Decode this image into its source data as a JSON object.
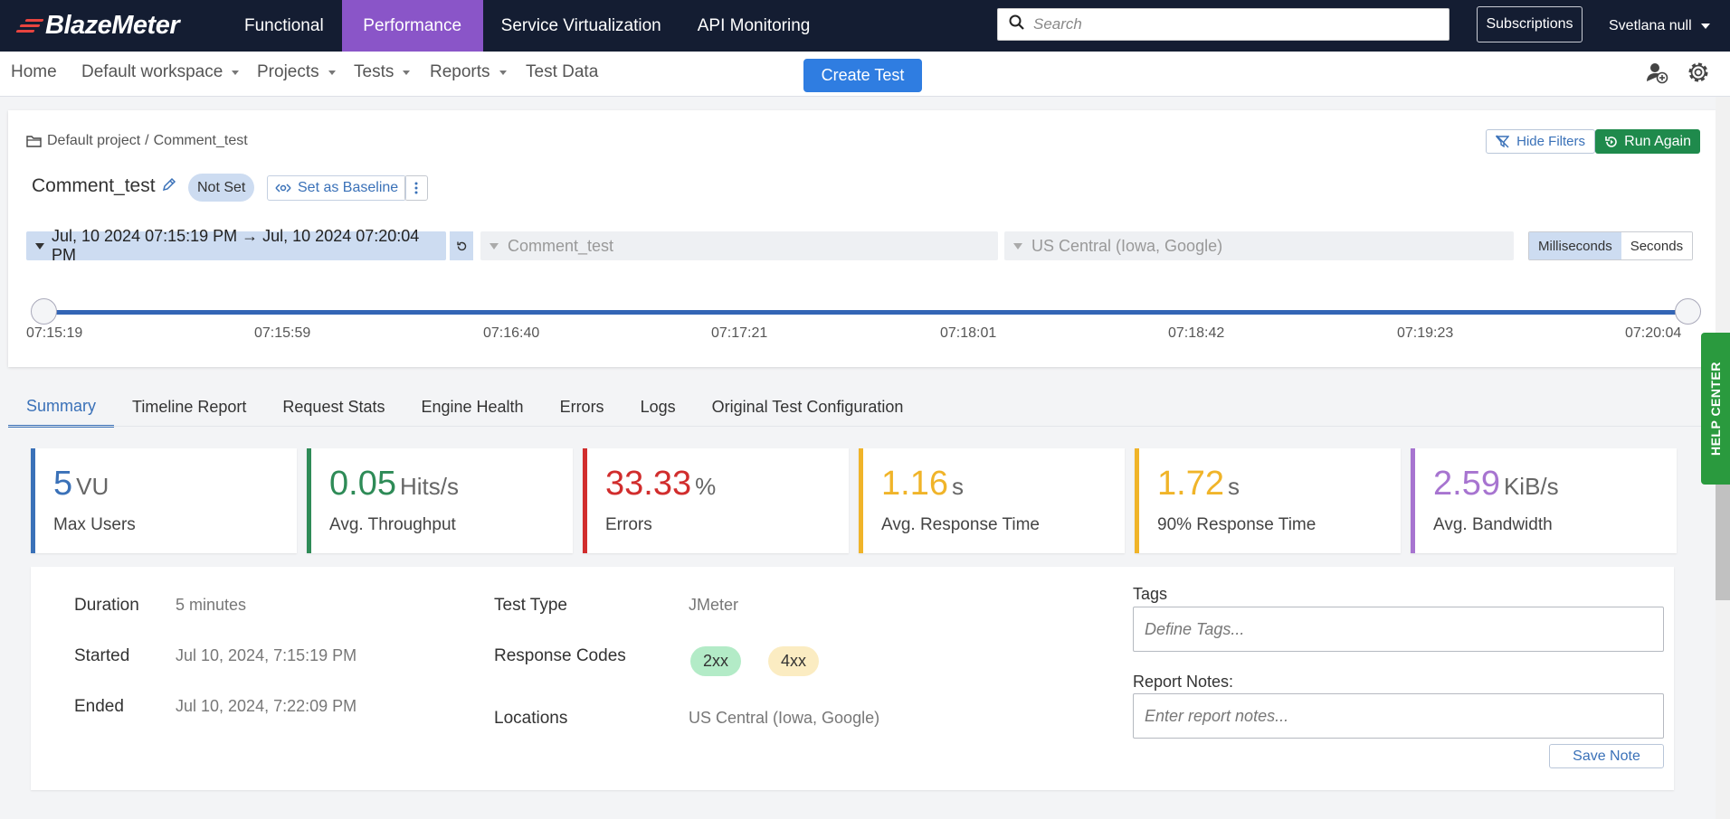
{
  "brand": {
    "logo_text": "BlazeMeter"
  },
  "topnav": {
    "items": [
      {
        "label": "Functional"
      },
      {
        "label": "Performance"
      },
      {
        "label": "Service Virtualization"
      },
      {
        "label": "API Monitoring"
      }
    ],
    "search_placeholder": "Search",
    "subscriptions_label": "Subscriptions",
    "user_name": "Svetlana null"
  },
  "subnav": {
    "home": "Home",
    "workspace": "Default workspace",
    "projects": "Projects",
    "tests": "Tests",
    "reports": "Reports",
    "test_data": "Test Data",
    "create_test": "Create Test"
  },
  "header": {
    "breadcrumb_project": "Default project",
    "breadcrumb_sep": "/",
    "breadcrumb_test": "Comment_test",
    "hide_filters": "Hide Filters",
    "run_again": "Run Again",
    "title": "Comment_test",
    "baseline_status": "Not Set",
    "set_baseline": "Set as Baseline",
    "date_range": "Jul, 10 2024 07:15:19 PM → Jul, 10 2024 07:20:04 PM",
    "scenario_filter": "Comment_test",
    "location_filter": "US Central (Iowa, Google)",
    "unit_ms": "Milliseconds",
    "unit_s": "Seconds",
    "timeline_ticks": [
      "07:15:19",
      "07:15:59",
      "07:16:40",
      "07:17:21",
      "07:18:01",
      "07:18:42",
      "07:19:23",
      "07:20:04"
    ]
  },
  "tabs": [
    {
      "label": "Summary"
    },
    {
      "label": "Timeline Report"
    },
    {
      "label": "Request Stats"
    },
    {
      "label": "Engine Health"
    },
    {
      "label": "Errors"
    },
    {
      "label": "Logs"
    },
    {
      "label": "Original Test Configuration"
    }
  ],
  "metrics": [
    {
      "value": "5",
      "unit": "VU",
      "label": "Max Users",
      "color": "#3a71b8"
    },
    {
      "value": "0.05",
      "unit": "Hits/s",
      "label": "Avg. Throughput",
      "color": "#2e8b57"
    },
    {
      "value": "33.33",
      "unit": "%",
      "label": "Errors",
      "color": "#d12d2d"
    },
    {
      "value": "1.16",
      "unit": "s",
      "label": "Avg. Response Time",
      "color": "#f0b429"
    },
    {
      "value": "1.72",
      "unit": "s",
      "label": "90% Response Time",
      "color": "#f0b429"
    },
    {
      "value": "2.59",
      "unit": "KiB/s",
      "label": "Avg. Bandwidth",
      "color": "#a774d0"
    }
  ],
  "details": {
    "duration_label": "Duration",
    "duration_value": "5 minutes",
    "started_label": "Started",
    "started_value": "Jul 10, 2024, 7:15:19 PM",
    "ended_label": "Ended",
    "ended_value": "Jul 10, 2024, 7:22:09 PM",
    "test_type_label": "Test Type",
    "test_type_value": "JMeter",
    "response_codes_label": "Response Codes",
    "response_codes": [
      "2xx",
      "4xx"
    ],
    "locations_label": "Locations",
    "locations_value": "US Central (Iowa, Google)",
    "tags_label": "Tags",
    "tags_placeholder": "Define Tags...",
    "notes_label": "Report Notes:",
    "notes_placeholder": "Enter report notes...",
    "save_note": "Save Note"
  },
  "help_center": "HELP CENTER"
}
